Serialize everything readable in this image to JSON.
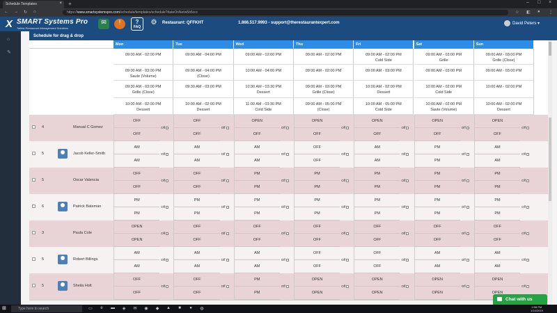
{
  "browser": {
    "tab_title": "Schedule Templates",
    "url_prefix": "https://",
    "url_host": "www.smartsystemspro.com",
    "url_path": "/schedule/templates/schedule?dateOnNetw5b5ccc",
    "new_tab_icon": "plus-icon",
    "nav": [
      "back-icon",
      "forward-icon",
      "reload-icon"
    ]
  },
  "app": {
    "logo_name": "SMART Systems Pro",
    "logo_tag": "Tallest Restaurant Management Solutions",
    "faq_label": "FAQ",
    "faq_q": "?",
    "restaurant_label": "Restaurant: QFFKHT",
    "contact": "1.866.517.9993 - support@therestaurantexpert.com",
    "user_name": "David Peters",
    "user_caret": "▾"
  },
  "panel": {
    "title": "Schedule for drag & drop"
  },
  "days": [
    "Mon",
    "Tue",
    "Wed",
    "Thu",
    "Fri",
    "Sat",
    "Sun"
  ],
  "templates": [
    [
      [
        "09:00 AM - 02:00 PM",
        ""
      ],
      [
        "09:00 AM - 04:00 PM",
        ""
      ],
      [
        "09:00 AM - 02:00 PM",
        ""
      ],
      [
        "09:00 AM - 02:00 PM",
        ""
      ],
      [
        "09:00 AM - 02:00 PM",
        "Cold Side"
      ],
      [
        "09:00 AM - 03:00 PM",
        "Grille"
      ],
      [
        "09:00 AM - 03:00 PM",
        "Grille (Close)"
      ]
    ],
    [
      [
        "09:00 AM - 03:00 PM",
        "Saute (Volume)"
      ],
      [
        "09:00 AM - 04:00 PM",
        "(Close)"
      ],
      [
        "10:00 AM - 04:00 PM",
        ""
      ],
      [
        "09:00 AM - 02:00 PM",
        ""
      ],
      [
        "09:00 AM - 03:00 PM",
        ""
      ],
      [
        "09:00 AM - 03:00 PM",
        ""
      ],
      [
        "09:00 AM - 03:00 PM",
        ""
      ]
    ],
    [
      [
        "09:30 AM - 03:00 PM",
        "Grille (Close)"
      ],
      [
        "09:30 AM - 03:00 PM",
        ""
      ],
      [
        "10:30 AM - 03:30 PM",
        "Dessert"
      ],
      [
        "09:00 AM - 03:00 PM",
        "Grille (Close)"
      ],
      [
        "10:00 AM - 02:00 PM",
        "Dessert"
      ],
      [
        "10:00 AM - 02:00 PM",
        "Cold Side"
      ],
      [
        "10:00 AM - 02:00 PM",
        ""
      ]
    ],
    [
      [
        "10:00 AM - 02:00 PM",
        "Dessert"
      ],
      [
        "10:00 AM - 02:00 PM",
        "Dessert"
      ],
      [
        "11:00 AM - 03:30 PM",
        "Cold Side"
      ],
      [
        "09:00 AM - 05:00 PM",
        "(Close)"
      ],
      [
        "10:00 AM - 05:00 PM",
        "Cold Side"
      ],
      [
        "10:00 AM - 02:00 PM",
        "Saute (Volume)"
      ],
      [
        "10:00 AM - 02:00 PM",
        "Dessert"
      ]
    ]
  ],
  "off_label": "Off",
  "employees": [
    {
      "num": "4",
      "name": "Manual C Gomez",
      "av": false,
      "slots": [
        [
          "OFF",
          "OFF"
        ],
        [
          "OFF",
          "OFF"
        ],
        [
          "OPEN",
          "OFF"
        ],
        [
          "OPEN",
          "OFF"
        ],
        [
          "OPEN",
          "OFF"
        ],
        [
          "OPEN",
          "OFF"
        ],
        [
          "OPEN",
          "OFF"
        ]
      ]
    },
    {
      "num": "5",
      "name": "Jacob Keller-Smith",
      "av": true,
      "slots": [
        [
          "AM",
          "AM"
        ],
        [
          "AM",
          "AM"
        ],
        [
          "AM",
          "AM"
        ],
        [
          "OFF",
          "OFF"
        ],
        [
          "AM",
          "AM"
        ],
        [
          "PM",
          "PM"
        ],
        [
          "AM",
          "AM"
        ]
      ]
    },
    {
      "num": "5",
      "name": "Oscar Valencia",
      "av": false,
      "slots": [
        [
          "OFF",
          "OFF"
        ],
        [
          "OFF",
          "OFF"
        ],
        [
          "PM",
          "PM"
        ],
        [
          "PM",
          "PM"
        ],
        [
          "PM",
          "PM"
        ],
        [
          "PM",
          "PM"
        ],
        [
          "PM",
          "PM"
        ]
      ]
    },
    {
      "num": "6",
      "name": "Patrick Bateman",
      "av": true,
      "slots": [
        [
          "PM",
          "PM"
        ],
        [
          "PM",
          "PM"
        ],
        [
          "PM",
          "PM"
        ],
        [
          "PM",
          "PM"
        ],
        [
          "PM",
          "PM"
        ],
        [
          "PM",
          "PM"
        ],
        [
          "PM",
          "PM"
        ]
      ]
    },
    {
      "num": "3",
      "name": "Paula Cole",
      "av": false,
      "slots": [
        [
          "OPEN",
          "OPEN"
        ],
        [
          "OFF",
          "OFF"
        ],
        [
          "OFF",
          "OFF"
        ],
        [
          "OFF",
          "OFF"
        ],
        [
          "OFF",
          "OFF"
        ],
        [
          "OFF",
          "OFF"
        ],
        [
          "OFF",
          "OFF"
        ]
      ]
    },
    {
      "num": "5",
      "name": "Robert Billings",
      "av": true,
      "slots": [
        [
          "AM",
          "AM"
        ],
        [
          "AM",
          "AM"
        ],
        [
          "AM",
          "AM"
        ],
        [
          "OFF",
          "OFF"
        ],
        [
          "OFF",
          "OFF"
        ],
        [
          "AM",
          "AM"
        ],
        [
          "AM",
          "AM"
        ]
      ]
    },
    {
      "num": "5",
      "name": "Sheila Holt",
      "av": true,
      "slots": [
        [
          "OFF",
          "OFF"
        ],
        [
          "OFF",
          "OFF"
        ],
        [
          "PM",
          "PM"
        ],
        [
          "OPEN",
          "OPEN"
        ],
        [
          "OPEN",
          "OPEN"
        ],
        [
          "OPEN",
          "OPEN"
        ],
        [
          "OPEN",
          "OPEN"
        ]
      ]
    }
  ],
  "taskbar": {
    "search_placeholder": "Type here to search",
    "time": "2:58 PM",
    "date": "1/14/2019"
  },
  "chat": {
    "label": "Chat with us"
  }
}
